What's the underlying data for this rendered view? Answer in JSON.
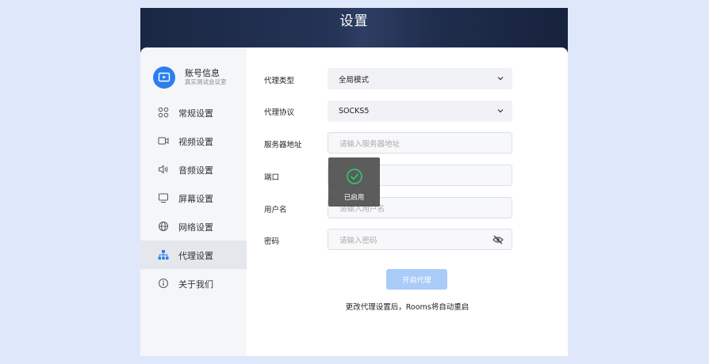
{
  "header": {
    "title": "设置"
  },
  "account": {
    "name": "账号信息",
    "subtitle": "真实测试会议室"
  },
  "sidebar": {
    "items": [
      {
        "label": "常规设置",
        "icon": "grid-icon"
      },
      {
        "label": "视频设置",
        "icon": "video-icon"
      },
      {
        "label": "音频设置",
        "icon": "speaker-icon"
      },
      {
        "label": "屏幕设置",
        "icon": "monitor-icon"
      },
      {
        "label": "网络设置",
        "icon": "globe-icon"
      },
      {
        "label": "代理设置",
        "icon": "sitemap-icon",
        "active": true
      },
      {
        "label": "关于我们",
        "icon": "info-icon"
      }
    ]
  },
  "form": {
    "proxy_type": {
      "label": "代理类型",
      "value": "全局模式"
    },
    "proxy_protocol": {
      "label": "代理协议",
      "value": "SOCKS5"
    },
    "server": {
      "label": "服务器地址",
      "placeholder": "请输入服务器地址"
    },
    "port": {
      "label": "端口",
      "placeholder": ""
    },
    "username": {
      "label": "用户名",
      "placeholder": "请输入用户名"
    },
    "password": {
      "label": "密码",
      "placeholder": "请输入密码"
    },
    "submit_label": "开启代理",
    "note": "更改代理设置后，Rooms将自动重启"
  },
  "toast": {
    "text": "已启用"
  },
  "colors": {
    "accent": "#2b7ef0",
    "button_disabled": "#a9ccf9",
    "success": "#2ecc71"
  }
}
